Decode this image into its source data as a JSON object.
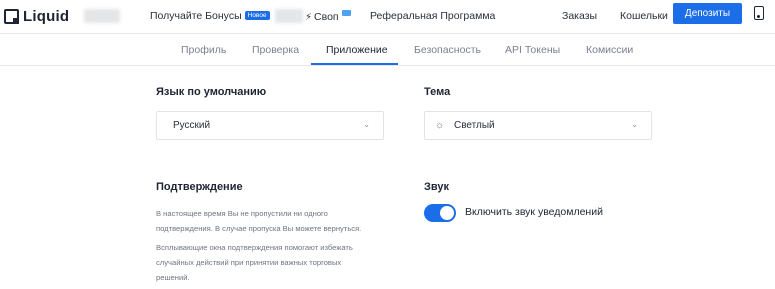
{
  "topnav": {
    "logo_text": "Liquid",
    "bonus_label": "Получайте Бонусы",
    "new_badge": "Новое",
    "swap_label": "Своп",
    "referral_label": "Реферальная Программа",
    "orders_label": "Заказы",
    "wallets_label": "Кошельки",
    "deposit_label": "Депозиты"
  },
  "tabs": [
    {
      "label": "Профиль",
      "active": false
    },
    {
      "label": "Проверка",
      "active": false
    },
    {
      "label": "Приложение",
      "active": true
    },
    {
      "label": "Безопасность",
      "active": false
    },
    {
      "label": "API Токены",
      "active": false
    },
    {
      "label": "Комиссии",
      "active": false
    }
  ],
  "language": {
    "title": "Язык по умолчанию",
    "selected": "Русский"
  },
  "theme": {
    "title": "Тема",
    "selected": "Светлый"
  },
  "confirmation": {
    "title": "Подтверждение",
    "paragraph1_line1": "В настоящее время Вы не пропустили ни одного",
    "paragraph1_line2": "подтверждения. В случае пропуска Вы можете вернуться.",
    "paragraph2_line1": "Всплывающие окна подтверждения помогают избежать",
    "paragraph2_line2": "случайных действий при принятии важных торговых",
    "paragraph2_line3": "решений."
  },
  "sound": {
    "title": "Звук",
    "toggle_label": "Включить звук уведомлений",
    "enabled": true
  },
  "colors": {
    "accent": "#1c6ee8",
    "text": "#1e2533",
    "muted": "#7b8190"
  }
}
